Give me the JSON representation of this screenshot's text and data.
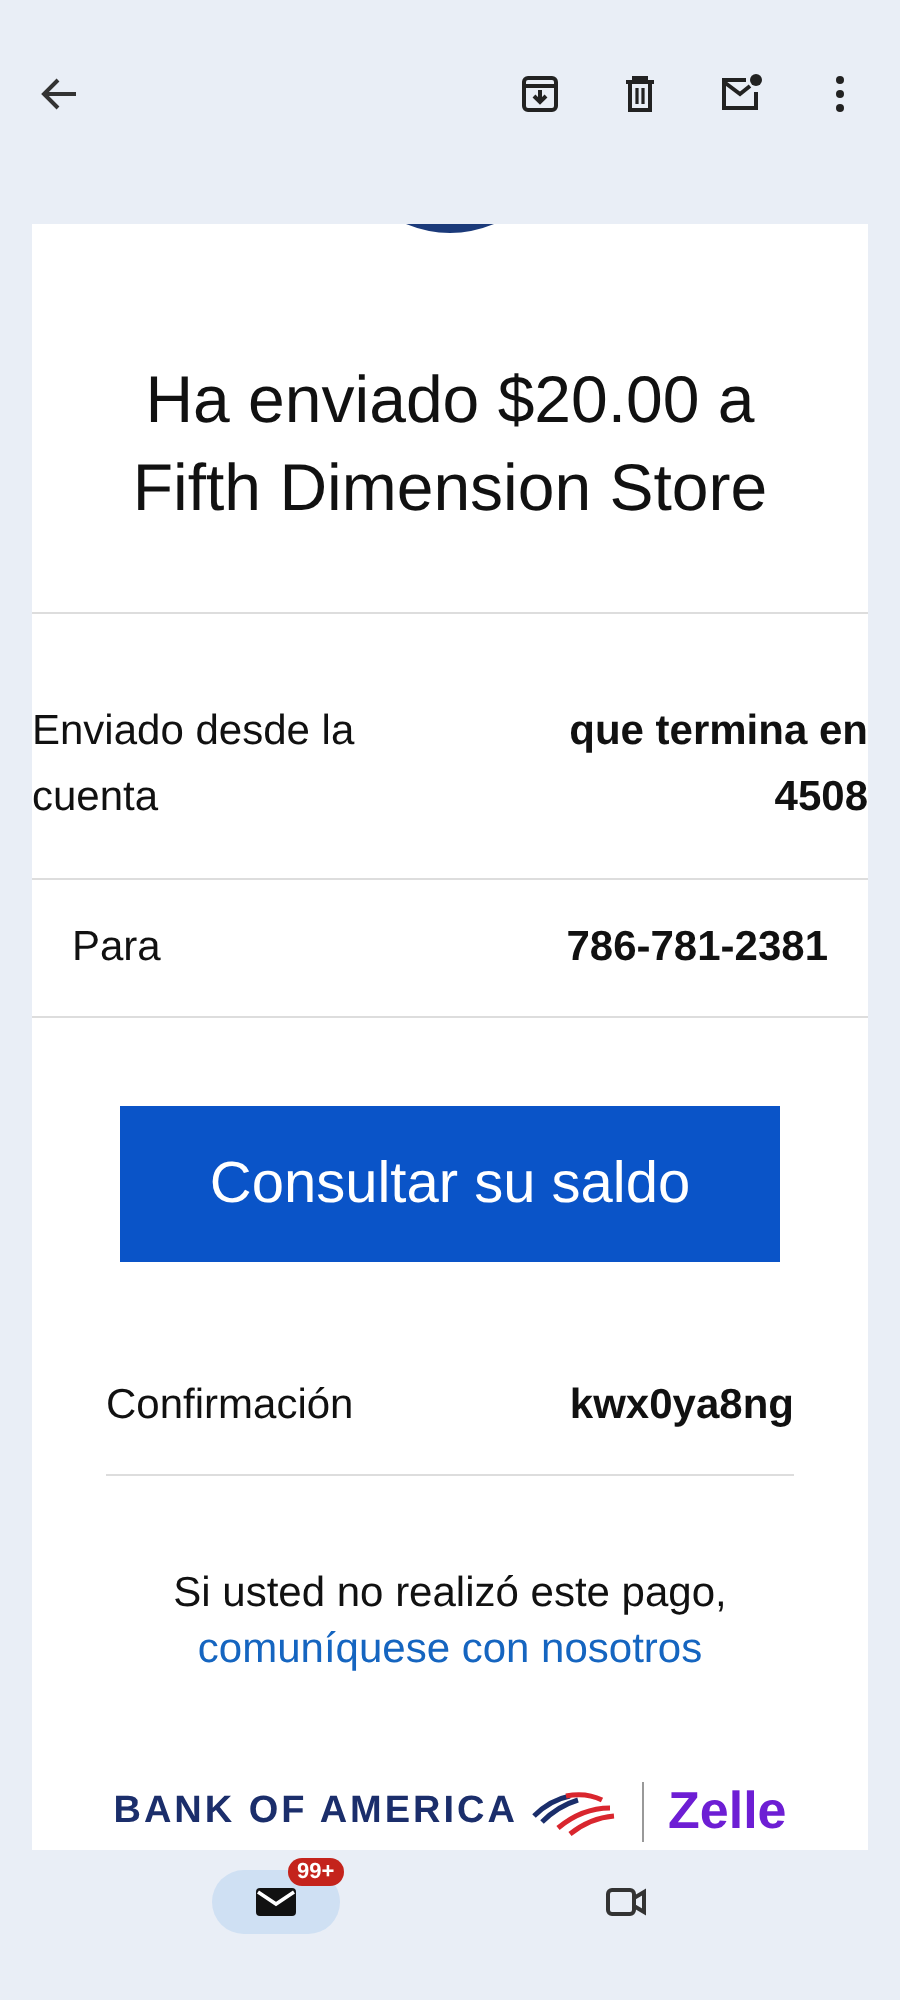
{
  "email": {
    "headline": "Ha enviado $20.00 a Fifth Dimension Store",
    "details": [
      {
        "label": "Enviado desde la cuenta",
        "value": "que termina en 4508",
        "kind": "wide"
      },
      {
        "label": "Para",
        "value": "786-781-2381",
        "kind": "inset"
      }
    ],
    "button": "Consultar su saldo",
    "confirmation": {
      "label": "Confirmación",
      "value": "kwx0ya8ng"
    },
    "notice": "Si usted no realizó este pago,",
    "link": "comuníquese con nosotros",
    "brand": "BANK OF AMERICA",
    "partner": "Zelle"
  },
  "bottom_nav": [
    {
      "kind": "mail",
      "selected": true,
      "badge": "99+"
    },
    {
      "kind": "video",
      "selected": false
    }
  ]
}
